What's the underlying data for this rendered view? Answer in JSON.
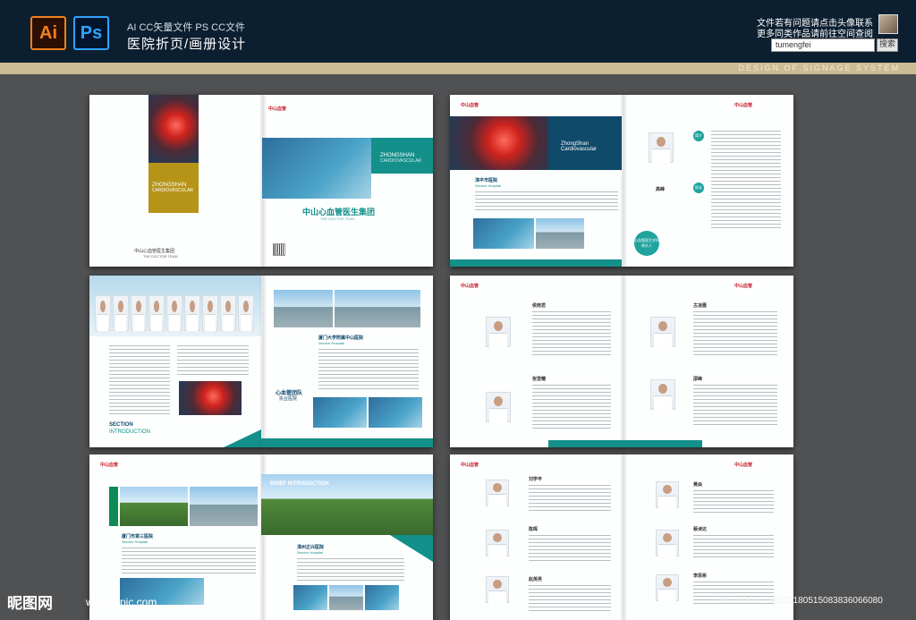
{
  "header": {
    "icons": [
      {
        "label": "Ai",
        "name": "illustrator-icon"
      },
      {
        "label": "Ps",
        "name": "photoshop-icon"
      }
    ],
    "subtitle": "AI CC矢量文件   PS CC文件",
    "title": "医院折页/画册设计",
    "notice_line1": "文件若有问题请点击头像联系",
    "notice_line2": "更多同类作品请前往空间查阅",
    "search_value": "tumengfei",
    "search_button": "搜索",
    "band_text": "DESIGN OF SIGNAGE SYSTEM"
  },
  "spread1": {
    "cover_en1": "ZHONGSHAN",
    "cover_en2": "CARDIOVASCULAR",
    "cover_cn": "中山心血管医生集团",
    "cover_en3": "THE DOCTOR TEAM",
    "banner_en1": "ZHONGSHAN",
    "banner_en2": "CARDIOVASCULAR",
    "main_title": "中山心血管医生集团",
    "main_sub": "THE DOCTOR TEAM",
    "logo": "中山血管"
  },
  "spread2": {
    "logo": "中山血管",
    "en1": "ZhongShan",
    "en2": "Cardiovascular",
    "hospital": "漳平市医院",
    "hospital_en": "Service Hospital",
    "doctor_name": "高峰",
    "badge_top": "简介",
    "badge_bottom": "擅长",
    "badge_round": "心血管医生学科带头人"
  },
  "spread3": {
    "section_title": "SECTION",
    "section_sub": "INTRODUCTION",
    "hospital": "厦门大学附属中山医院",
    "hospital_en": "Service Hospital",
    "team_cn": "心血管团队",
    "team_cn2": "执业医院"
  },
  "spread4": {
    "logo": "中山血管",
    "doctors": [
      "侯晓君",
      "古凌雁",
      "张登耀",
      "邵峰"
    ]
  },
  "spread5": {
    "logo": "中山血管",
    "hospital": "厦门市第三医院",
    "hospital_en": "Service Hospital",
    "brief": "BRIEF INTRODUCTION",
    "hospital2": "漳州正兴医院",
    "hospital2_en": "Service Hospital"
  },
  "spread6": {
    "logo": "中山血管",
    "doctors": [
      "刘学丰",
      "黄焱",
      "陈晖",
      "蔡诗达",
      "赵英男",
      "李思彬"
    ]
  },
  "watermark": {
    "brand": "昵图网",
    "url": "www.nipic.com",
    "id_line": "ID:1019117 NO:20180515083836066080"
  },
  "colors": {
    "teal": "#13908a",
    "navy": "#0f4a6b",
    "gold": "#cdbb94",
    "header": "#0c1f30"
  }
}
